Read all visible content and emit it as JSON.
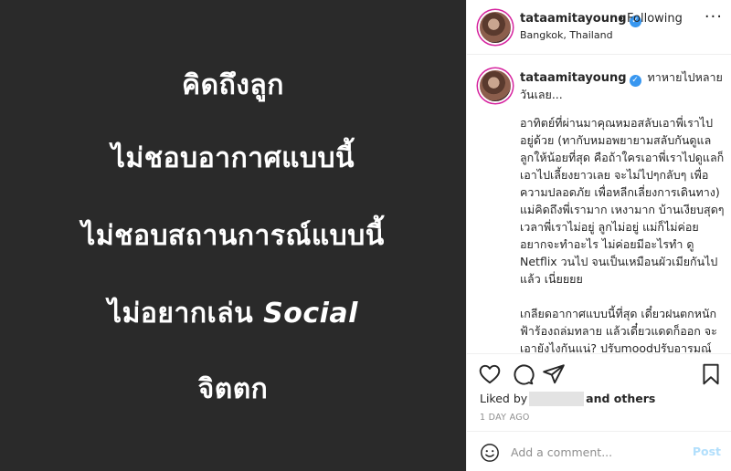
{
  "post": {
    "lines": [
      "คิดถึงลูก",
      "ไม่ชอบอากาศแบบนี้",
      "ไม่ชอบสถานการณ์แบบนี้",
      "ไม่อยากเล่น",
      "จิตตก"
    ],
    "line4_en": "Social"
  },
  "header": {
    "username": "tataamitayoung",
    "separator": "•",
    "follow_label": "Following",
    "location": "Bangkok, Thailand",
    "more_icon": "more-icon"
  },
  "caption": {
    "username": "tataamitayoung",
    "first": "ทาหายไปหลายวันเลย...",
    "body": "อาทิตย์ที่ผ่านมาคุณหมอสลับเอาพี่เราไปอยู่ด้วย (ทากับหมอพยายามสลับกันดูแลลูกให้น้อยที่สุด คือถ้าใครเอาพี่เราไปดูแลก็เอาไปเลี้ยงยาวเลย จะไม่ไปๆกลับๆ เพื่อความปลอดภัย เพื่อหลีกเลี่ยงการเดินทาง) แม่คิดถึงพี่เรามาก เหงามาก บ้านเงียบสุดๆ เวลาพี่เราไม่อยู่ ลูกไม่อยู่ แม่ก็ไม่ค่อยอยากจะทำอะไร ไม่ค่อยมีอะไรทำ ดู Netflix วนไป จนเป็นเหมือนผัวเมียกันไปแล้ว เนี่ยยยย\n\nเกลียดอากาศแบบนี้ที่สุด เดี๋ยวฝนตกหนักฟ้าร้องถล่มทลาย แล้วเดี๋ยวแดดก็ออก จะเอายังไงกันแน่? ปรับmoodปรับอารมณ์ไม่ถูก ออกไปไหนก็ไม่ได้ ไม่ควรออกอย่างยิ่ง (ตัวเลขผู้ติดเชื้อแบบนี้ มนุษย์แม่อย่างเราไม่ควรออก มีลูกเล็กเป็นอะไรมาไม่คุ้มกัน"
  },
  "likes": {
    "prefix": "Liked by",
    "suffix": "and others"
  },
  "timestamp": "1 DAY AGO",
  "comment": {
    "placeholder": "Add a comment...",
    "post_label": "Post"
  },
  "colors": {
    "image_bg": "#2a2a2a",
    "verified": "#3897f0",
    "post_disabled": "#b2dffc",
    "muted": "#8e8e8e"
  }
}
